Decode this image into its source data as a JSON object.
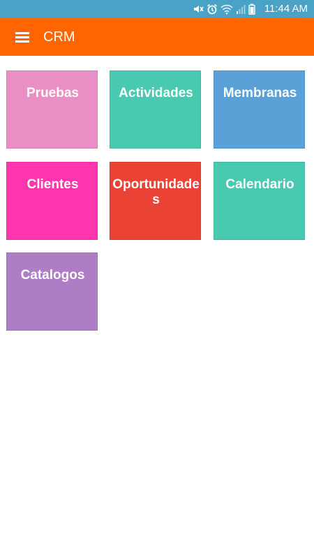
{
  "status_bar": {
    "time": "11:44 AM",
    "icons": [
      "mute-icon",
      "alarm-icon",
      "wifi-icon",
      "signal-icon",
      "battery-icon"
    ]
  },
  "app_bar": {
    "title": "CRM",
    "menu_icon": "hamburger-menu-icon"
  },
  "colors": {
    "status_bar": "#4aa3c7",
    "app_bar": "#ff6600"
  },
  "tiles": [
    {
      "label": "Pruebas",
      "color": "#ea8fc5"
    },
    {
      "label": "Actividades",
      "color": "#49c9b0"
    },
    {
      "label": "Membranas",
      "color": "#5aa1d8"
    },
    {
      "label": "Clientes",
      "color": "#ff35ad"
    },
    {
      "label": "Oportunidades",
      "color": "#ea4335"
    },
    {
      "label": "Calendario",
      "color": "#49c9b0"
    },
    {
      "label": "Catalogos",
      "color": "#ae7dc6"
    }
  ]
}
